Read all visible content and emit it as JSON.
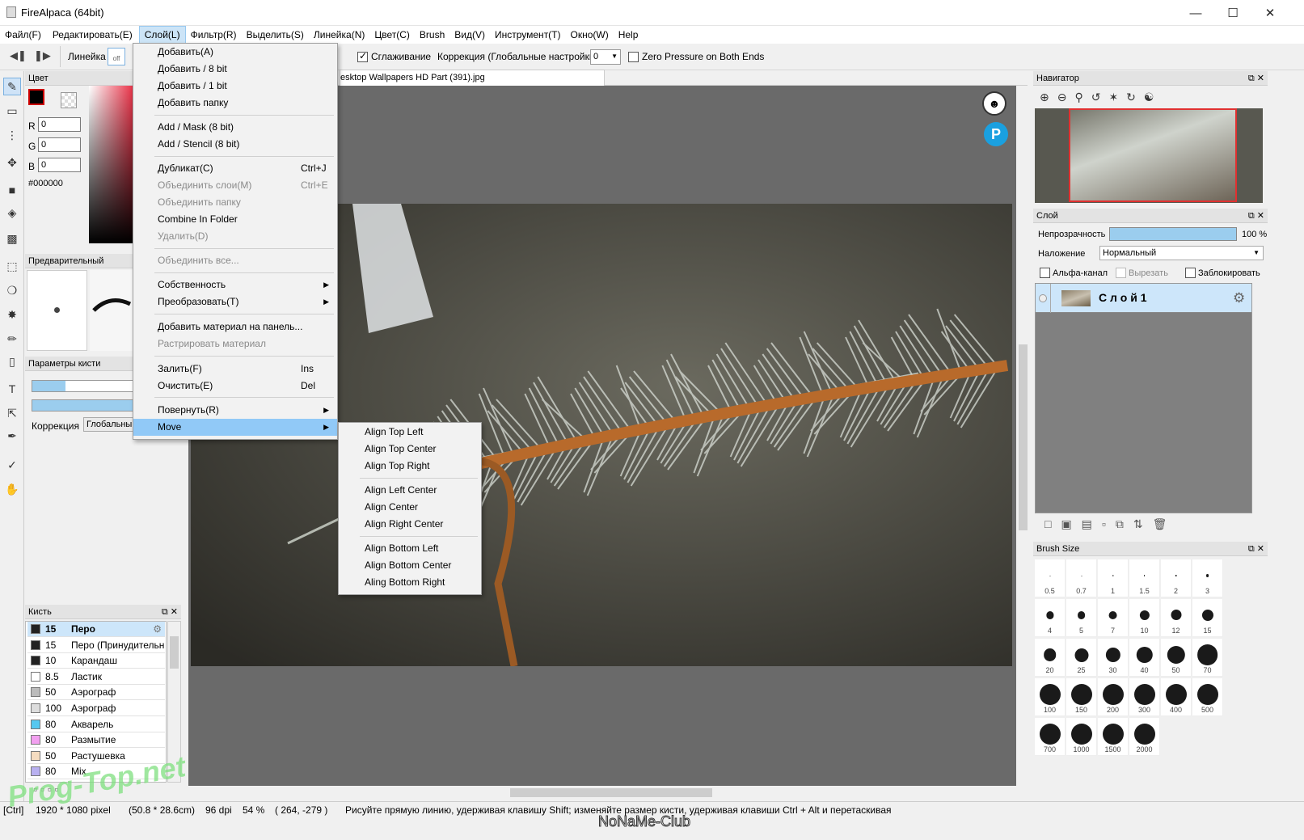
{
  "app": {
    "title": "FireAlpaca (64bit)"
  },
  "menubar": [
    "Файл(F)",
    "Редактировать(E)",
    "Слой(L)",
    "Фильтр(R)",
    "Выделить(S)",
    "Линейка(N)",
    "Цвет(C)",
    "Brush",
    "Вид(V)",
    "Инструмент(T)",
    "Окно(W)",
    "Help"
  ],
  "toolbar": {
    "ruler_label": "Линейка",
    "ruler_state": "off",
    "antialias_label": "Сглаживание",
    "correction_label": "Коррекция (Глобальные настройки)",
    "correction_value": "0",
    "zero_pressure_label": "Zero Pressure on Both Ends"
  },
  "color_panel": {
    "title": "Цвет",
    "r_label": "R",
    "r": "0",
    "g_label": "G",
    "g": "0",
    "b_label": "B",
    "b": "0",
    "hex": "#000000"
  },
  "preview_panel": {
    "title": "Предварительный просмо"
  },
  "brush_params": {
    "title": "Параметры кисти",
    "correction_label": "Коррекция",
    "correction_value": "Глобальны"
  },
  "brush_panel": {
    "title": "Кисть",
    "items": [
      {
        "size": "15",
        "name": "Перо",
        "color": "#222222"
      },
      {
        "size": "15",
        "name": "Перо (Принудительн",
        "color": "#222222"
      },
      {
        "size": "10",
        "name": "Карандаш",
        "color": "#222222"
      },
      {
        "size": "8.5",
        "name": "Ластик",
        "color": "#ffffff"
      },
      {
        "size": "50",
        "name": "Аэрограф",
        "color": "#bbbbbb"
      },
      {
        "size": "100",
        "name": "Аэрограф",
        "color": "#dddddd"
      },
      {
        "size": "80",
        "name": "Акварель",
        "color": "#55c8f0"
      },
      {
        "size": "80",
        "name": "Размытие",
        "color": "#f2a0f0"
      },
      {
        "size": "50",
        "name": "Растушевка",
        "color": "#f5dcc0"
      },
      {
        "size": "80",
        "name": "Mix",
        "color": "#b8b0f0"
      }
    ]
  },
  "doc_tab": "esktop Wallpapers HD Part (391).jpg",
  "layer_menu": {
    "items": [
      {
        "label": "Добавить(A)",
        "shortcut": "",
        "disabled": false
      },
      {
        "label": "Добавить / 8 bit",
        "shortcut": "",
        "disabled": false
      },
      {
        "label": "Добавить / 1 bit",
        "shortcut": "",
        "disabled": false
      },
      {
        "label": "Добавить папку",
        "shortcut": "",
        "disabled": false
      },
      {
        "label": "Add / Mask (8 bit)",
        "shortcut": "",
        "disabled": false
      },
      {
        "label": "Add / Stencil (8 bit)",
        "shortcut": "",
        "disabled": false
      },
      {
        "label": "Дубликат(C)",
        "shortcut": "Ctrl+J",
        "disabled": false
      },
      {
        "label": "Объединить слои(M)",
        "shortcut": "Ctrl+E",
        "disabled": true
      },
      {
        "label": "Объединить папку",
        "shortcut": "",
        "disabled": true
      },
      {
        "label": "Combine In Folder",
        "shortcut": "",
        "disabled": false
      },
      {
        "label": "Удалить(D)",
        "shortcut": "",
        "disabled": true
      },
      {
        "label": "Объединить все...",
        "shortcut": "",
        "disabled": true
      },
      {
        "label": "Собственность",
        "shortcut": "",
        "disabled": false
      },
      {
        "label": "Преобразовать(T)",
        "shortcut": "",
        "disabled": false
      },
      {
        "label": "Добавить материал на панель...",
        "shortcut": "",
        "disabled": false
      },
      {
        "label": "Растрировать материал",
        "shortcut": "",
        "disabled": true
      },
      {
        "label": "Залить(F)",
        "shortcut": "Ins",
        "disabled": false
      },
      {
        "label": "Очистить(E)",
        "shortcut": "Del",
        "disabled": false
      },
      {
        "label": "Повернуть(R)",
        "shortcut": "",
        "disabled": false
      },
      {
        "label": "Move",
        "shortcut": "",
        "disabled": false
      }
    ]
  },
  "move_submenu": [
    "Align Top Left",
    "Align Top Center",
    "Align Top Right",
    "Align Left Center",
    "Align Center",
    "Align Right Center",
    "Align Bottom Left",
    "Align Bottom Center",
    "Aling Bottom Right"
  ],
  "navigator": {
    "title": "Навигатор"
  },
  "layer_panel": {
    "title": "Слой",
    "opacity_label": "Непрозрачность",
    "opacity_value": "100 %",
    "opacity_fraction": 1.0,
    "blend_label": "Наложение",
    "blend_value": "Нормальный",
    "alpha_label": "Альфа-канал",
    "clip_label": "Вырезать",
    "lock_label": "Заблокировать",
    "layer_name": "С л о й 1"
  },
  "brush_size_panel": {
    "title": "Brush Size",
    "sizes": [
      "0.5",
      "0.7",
      "1",
      "1.5",
      "2",
      "3",
      "4",
      "5",
      "7",
      "10",
      "12",
      "15",
      "20",
      "25",
      "30",
      "40",
      "50",
      "70",
      "100",
      "150",
      "200",
      "300",
      "400",
      "500",
      "700",
      "1000",
      "1500",
      "2000"
    ]
  },
  "status_bar": {
    "mode": "[Ctrl]",
    "dimensions": "1920 * 1080 pixel",
    "physical": "(50.8 * 28.6cm)",
    "dpi": "96 dpi",
    "zoom": "54 %",
    "coords": "( 264, -279 )",
    "hint": "Рисуйте прямую линию, удерживая клавишу Shift; изменяйте размер кисти, удерживая клавиши Ctrl + Alt и перетаскивая"
  },
  "watermarks": {
    "left": "Prog-Top.net",
    "center": "NoNaMe-Club"
  },
  "colors": {
    "accent": "#91c9f7",
    "canvas_bg": "#6a6a6a",
    "selection": "#cde6fa"
  }
}
